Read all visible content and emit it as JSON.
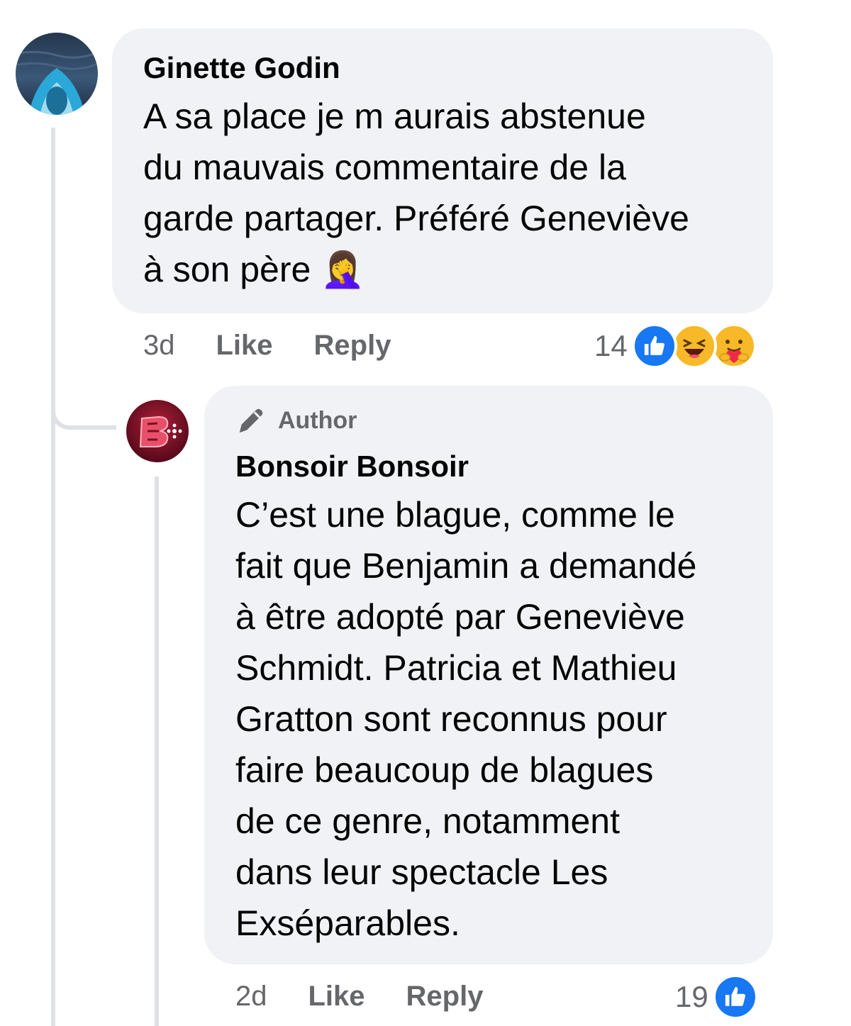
{
  "comments": [
    {
      "author": "Ginette Godin",
      "text": "A sa place je m aurais abstenue\ndu mauvais commentaire de la\ngarde partager. Préféré Geneviève\nà son père",
      "emoji": "🤦‍♀️",
      "time": "3d",
      "like_label": "Like",
      "reply_label": "Reply",
      "reaction_count": "14",
      "reactions": [
        "like-icon",
        "haha-icon",
        "care-icon"
      ]
    },
    {
      "badge": "Author",
      "author": "Bonsoir Bonsoir",
      "text": "C’est une blague, comme le\nfait que Benjamin a demandé\nà être adopté par Geneviève\nSchmidt. Patricia et Mathieu\nGratton sont reconnus pour\nfaire beaucoup de blagues\nde ce genre, notamment\ndans leur spectacle Les\nExséparables.",
      "time": "2d",
      "like_label": "Like",
      "reply_label": "Reply",
      "reaction_count": "19",
      "reactions": [
        "like-icon"
      ]
    }
  ],
  "colors": {
    "bubble": "#f0f2f5",
    "meta_text": "#65676b",
    "like_blue": "#1877f2",
    "thread_line": "#dfe1e5"
  }
}
